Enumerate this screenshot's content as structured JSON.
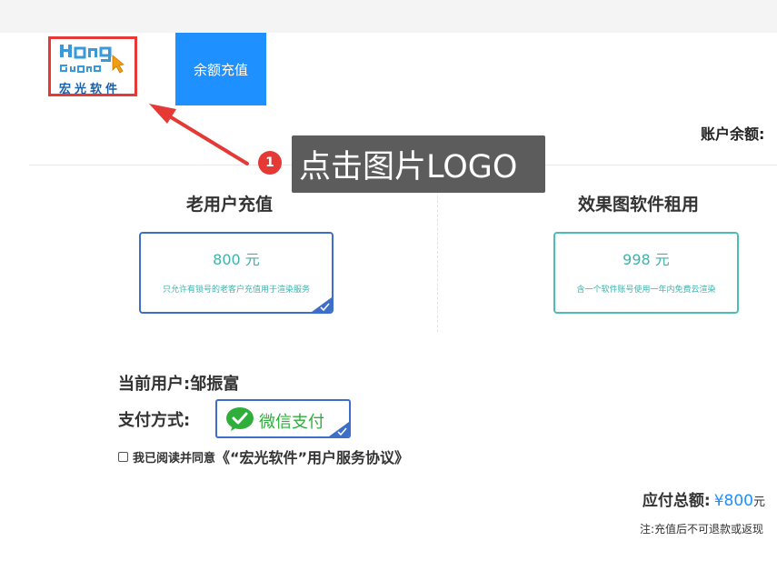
{
  "header": {
    "logo": {
      "top_text": "Hong Guang",
      "cn_text": "宏光软件",
      "border_color": "#e53935"
    },
    "recharge_tab": "余额充值",
    "balance_label": "账户余额:"
  },
  "annotation": {
    "step_number": "1",
    "callout_text": "点击图片LOGO",
    "arrow_color": "#e53935"
  },
  "plans": [
    {
      "title": "老用户充值",
      "price": "800 元",
      "description": "只允许有锁号的老客户充值用于渲染服务",
      "selected": true
    },
    {
      "title": "效果图软件租用",
      "price": "998 元",
      "description": "含一个软件账号使用一年内免费云渲染",
      "selected": false
    }
  ],
  "account": {
    "current_user_label": "当前用户:",
    "current_user": "邹振富",
    "payment_label": "支付方式:",
    "payment_method": "微信支付"
  },
  "agreement": {
    "checked": false,
    "text": "我已阅读并同意",
    "link": "《“宏光软件”用户服务协议》"
  },
  "summary": {
    "total_label": "应付总额:",
    "total_amount": "¥800",
    "total_unit": "元",
    "note": "注:充值后不可退款或返现"
  },
  "colors": {
    "accent_blue": "#1e90ff",
    "selected_border": "#3d6ec9",
    "teal": "#3fb3ac",
    "wechat_green": "#2fae3c"
  }
}
